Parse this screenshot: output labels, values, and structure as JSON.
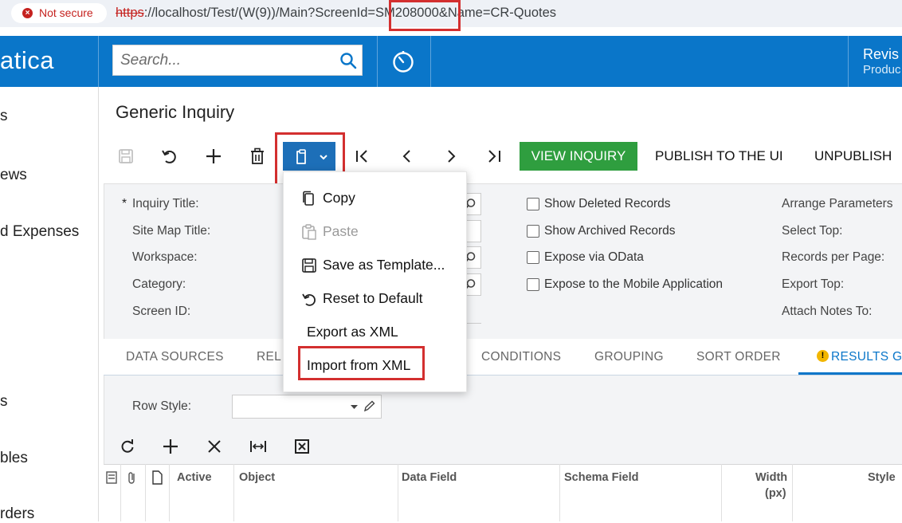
{
  "browser": {
    "security_label": "Not secure",
    "url_protocol": "https",
    "url_rest": "://localhost/Test/(W(9))/Main?ScreenId=SM208000&Name=CR-Quotes"
  },
  "header": {
    "logo": "atica",
    "search_placeholder": "Search...",
    "branch_name": "Revis",
    "branch_sub": "Produc"
  },
  "leftnav": {
    "items": [
      "s",
      "ews",
      "d Expenses",
      "s",
      "bles",
      "rders"
    ]
  },
  "page": {
    "title": "Generic Inquiry"
  },
  "toolbar": {
    "view_inquiry": "VIEW INQUIRY",
    "publish": "PUBLISH TO THE UI",
    "unpublish": "UNPUBLISH"
  },
  "menu": {
    "items": [
      {
        "label": "Copy",
        "icon": "copy-icon",
        "enabled": true
      },
      {
        "label": "Paste",
        "icon": "paste-icon",
        "enabled": false
      },
      {
        "label": "Save as Template...",
        "icon": "save-icon",
        "enabled": true
      },
      {
        "label": "Reset to Default",
        "icon": "undo-icon",
        "enabled": true
      },
      {
        "label": "Export as XML",
        "icon": "",
        "enabled": true
      },
      {
        "label": "Import from XML",
        "icon": "",
        "enabled": true
      }
    ]
  },
  "form": {
    "labels": {
      "inquiry_title": "Inquiry Title:",
      "site_map_title": "Site Map Title:",
      "workspace": "Workspace:",
      "category": "Category:",
      "screen_id": "Screen ID:"
    },
    "required_mark": "*",
    "checkboxes": [
      "Show Deleted Records",
      "Show Archived Records",
      "Expose via OData",
      "Expose to the Mobile Application"
    ],
    "right_labels": {
      "arrange": "Arrange Parameters",
      "select_top": "Select Top:",
      "records_per_page": "Records per Page:",
      "export_top": "Export Top:",
      "attach_notes": "Attach Notes To:"
    }
  },
  "tabs": {
    "data_sources": "DATA SOURCES",
    "relations": "REL",
    "conditions": "CONDITIONS",
    "grouping": "GROUPING",
    "sort_order": "SORT ORDER",
    "results_grid": "RESULTS G"
  },
  "grid": {
    "row_style_label": "Row Style:",
    "headers": {
      "active": "Active",
      "object": "Object",
      "data_field": "Data Field",
      "schema_field": "Schema Field",
      "width": "Width",
      "width_unit": "(px)",
      "style": "Style"
    }
  },
  "colors": {
    "header_blue": "#0a76c9",
    "view_inquiry_green": "#2f9e3f",
    "highlight_red": "#d32f2f"
  }
}
